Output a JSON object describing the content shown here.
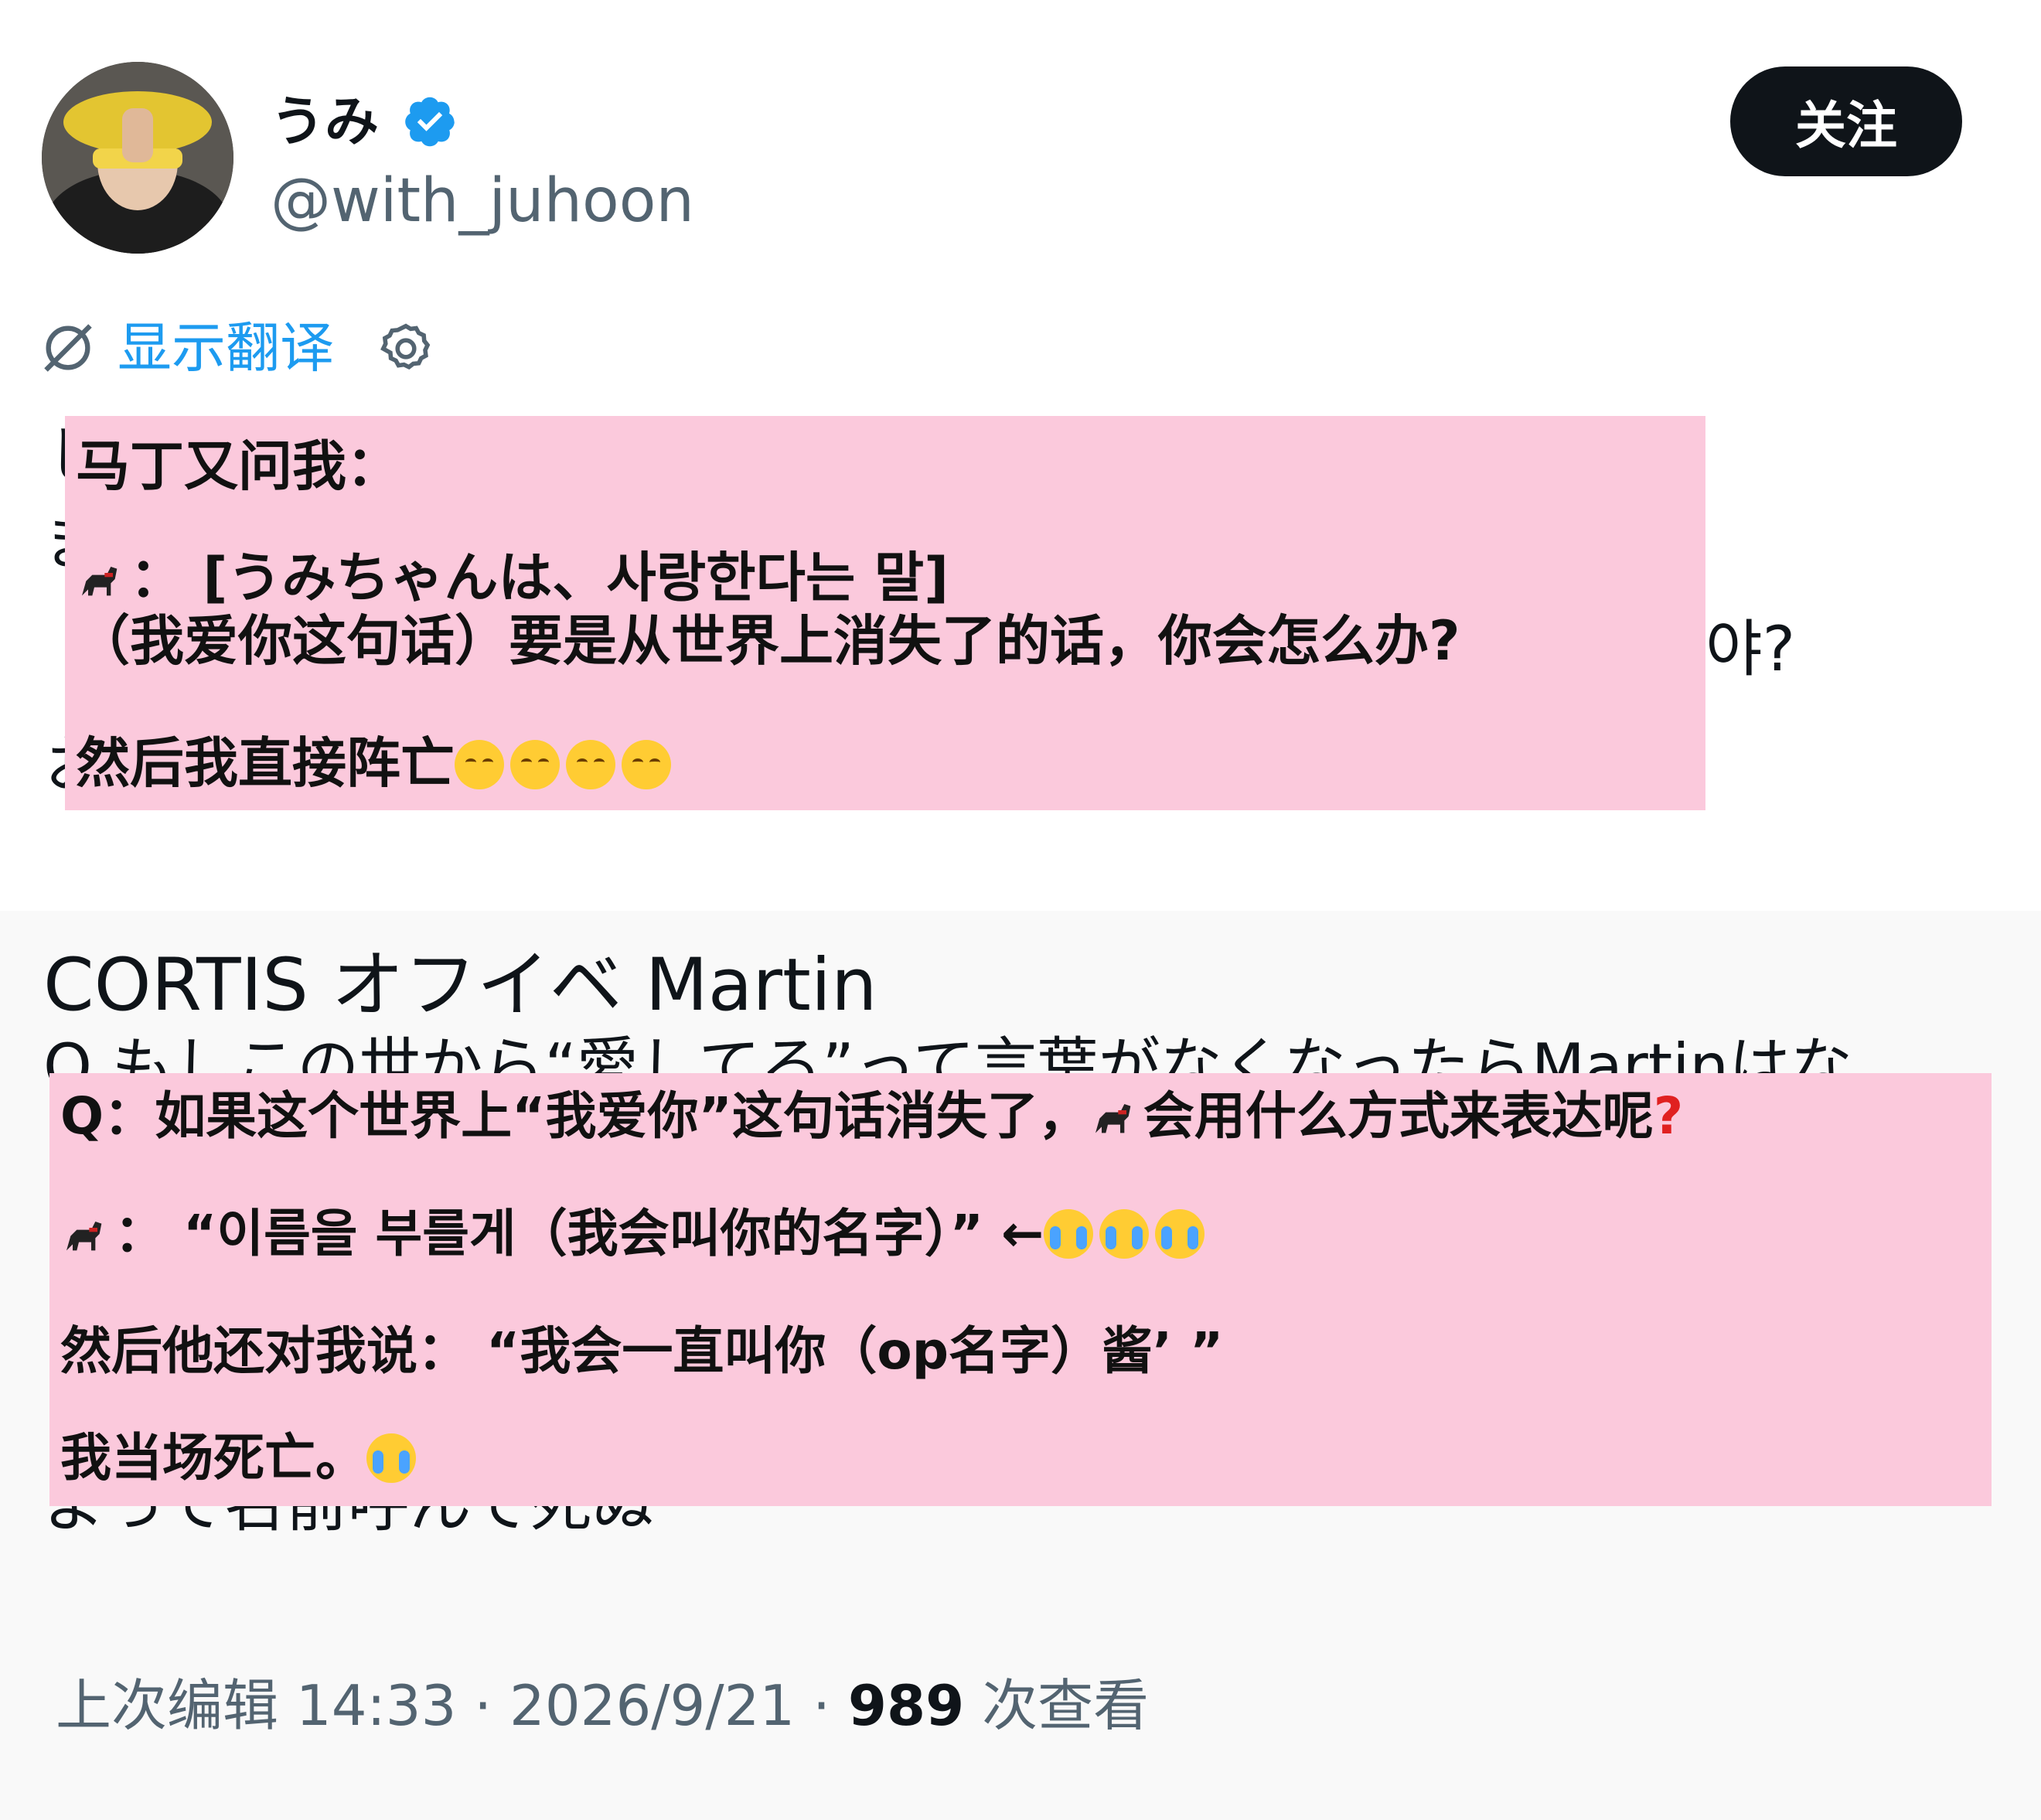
{
  "header": {
    "display_name": "うみ",
    "handle": "@with_juhoon",
    "follow_label": "关注",
    "verified_icon": "verified-badge-icon"
  },
  "translate": {
    "label": "显示翻译"
  },
  "tweet_fragments": {
    "frag_1": "し",
    "frag_2": "ま",
    "frag_3": "야?",
    "frag_4": "お"
  },
  "overlay_1": {
    "line_1": "马丁又问我：",
    "line_2": "：  [うみちゃんは、사랑한다는 말]",
    "line_3": "（我爱你这句话）要是从世界上消失了的话，你会怎么办?",
    "line_4": "然后我直接阵亡"
  },
  "quoted": {
    "title": "CORTIS オフイベ Martin",
    "ghost_line_1": "Q.もしこの世から“愛してる”って言葉がなくなったらMartinはな",
    "ghost_line_2": "よって名前呼んで死ぬ"
  },
  "overlay_2": {
    "line_1": "Q：如果这个世界上“我爱你”这句话消失了，",
    "line_1b": "会用什么方式来表达呢",
    "line_1_mark": "?",
    "line_2": "：  “이름을 부를게（我会叫你的名字）”  ←",
    "line_3": "然后他还对我说：  “我会一直叫你（op名字）酱’  ”",
    "line_4": "我当场死亡。"
  },
  "footer": {
    "edited": "上次编辑 14:33 · 2026/9/21 · ",
    "views_count": "989",
    "views_label": " 次查看"
  },
  "colors": {
    "accent": "#1d9bf0",
    "overlay": "#fbc9dc",
    "button_bg": "#0f1419"
  }
}
